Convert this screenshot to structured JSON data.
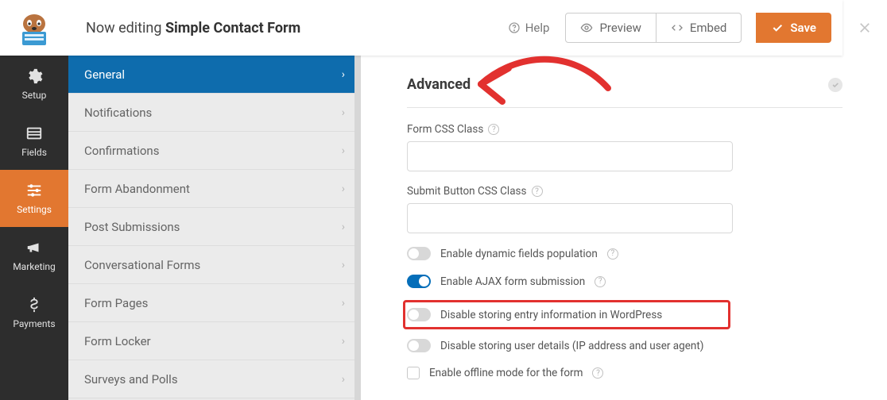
{
  "header": {
    "title_prefix": "Now editing ",
    "title_form": "Simple Contact Form",
    "help": "Help",
    "preview": "Preview",
    "embed": "Embed",
    "save": "Save"
  },
  "nav": {
    "items": [
      {
        "id": "setup",
        "label": "Setup"
      },
      {
        "id": "fields",
        "label": "Fields"
      },
      {
        "id": "settings",
        "label": "Settings"
      },
      {
        "id": "marketing",
        "label": "Marketing"
      },
      {
        "id": "payments",
        "label": "Payments"
      }
    ]
  },
  "sidebar": {
    "items": [
      {
        "label": "General"
      },
      {
        "label": "Notifications"
      },
      {
        "label": "Confirmations"
      },
      {
        "label": "Form Abandonment"
      },
      {
        "label": "Post Submissions"
      },
      {
        "label": "Conversational Forms"
      },
      {
        "label": "Form Pages"
      },
      {
        "label": "Form Locker"
      },
      {
        "label": "Surveys and Polls"
      }
    ]
  },
  "panel": {
    "heading": "Advanced",
    "form_css_label": "Form CSS Class",
    "submit_css_label": "Submit Button CSS Class",
    "toggles": {
      "dynamic": "Enable dynamic fields population",
      "ajax": "Enable AJAX form submission",
      "disable_entry": "Disable storing entry information in WordPress",
      "disable_user": "Disable storing user details (IP address and user agent)",
      "offline": "Enable offline mode for the form"
    }
  }
}
